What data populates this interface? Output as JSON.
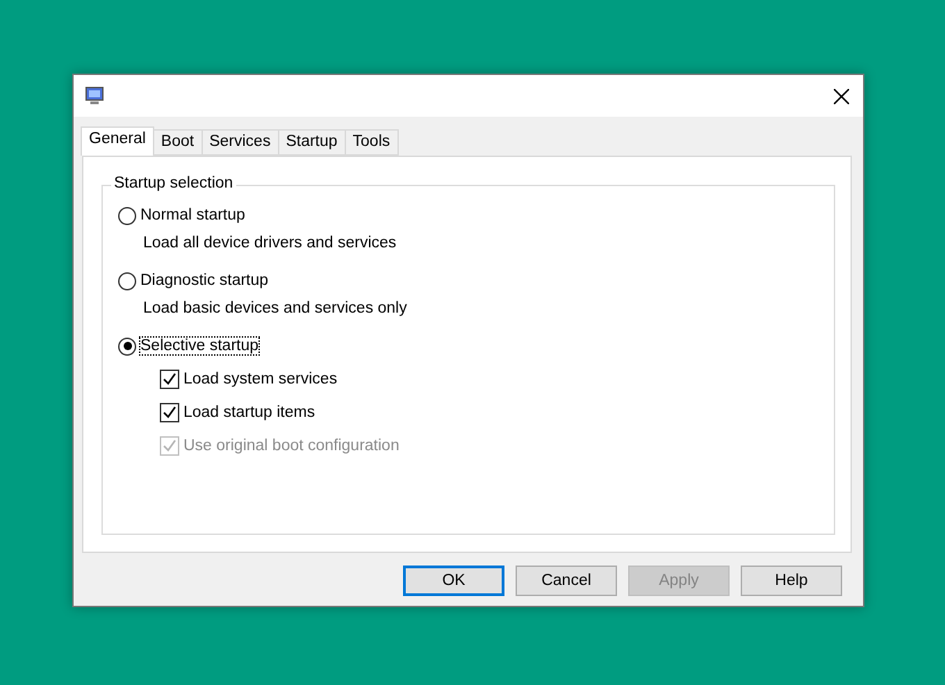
{
  "tabs": [
    {
      "label": "General",
      "selected": true
    },
    {
      "label": "Boot",
      "selected": false
    },
    {
      "label": "Services",
      "selected": false
    },
    {
      "label": "Startup",
      "selected": false
    },
    {
      "label": "Tools",
      "selected": false
    }
  ],
  "startup_selection": {
    "title": "Startup selection",
    "options": [
      {
        "label": "Normal startup",
        "description": "Load all device drivers and services",
        "selected": false
      },
      {
        "label": "Diagnostic startup",
        "description": "Load basic devices and services only",
        "selected": false
      },
      {
        "label": "Selective startup",
        "selected": true,
        "children": [
          {
            "label": "Load system services",
            "checked": true,
            "disabled": false
          },
          {
            "label": "Load startup items",
            "checked": true,
            "disabled": false
          },
          {
            "label": "Use original boot configuration",
            "checked": true,
            "disabled": true
          }
        ]
      }
    ]
  },
  "buttons": [
    {
      "label": "OK",
      "default": true,
      "disabled": false
    },
    {
      "label": "Cancel",
      "default": false,
      "disabled": false
    },
    {
      "label": "Apply",
      "default": false,
      "disabled": true
    },
    {
      "label": "Help",
      "default": false,
      "disabled": false
    }
  ]
}
